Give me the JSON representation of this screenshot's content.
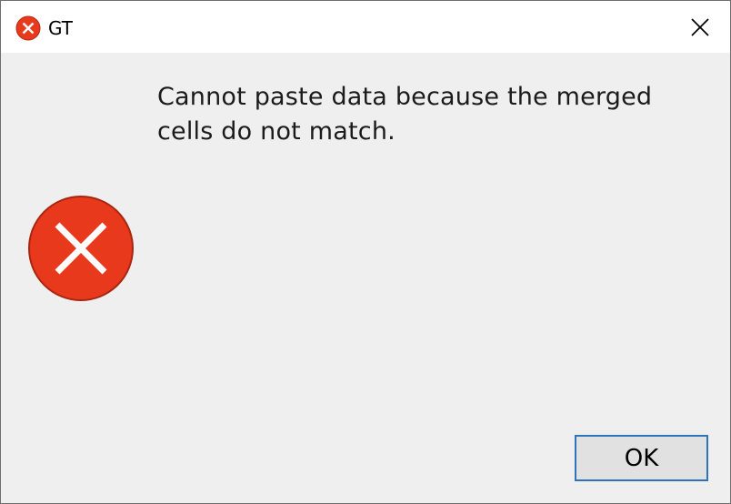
{
  "window": {
    "title": "GT",
    "title_icon": "error-circle-icon",
    "close_icon": "close-icon"
  },
  "dialog": {
    "message": "Cannot paste data because the merged cells do not match.",
    "icon": "error-icon",
    "ok_label": "OK"
  },
  "colors": {
    "error_red": "#e8391d",
    "button_border": "#2f73b9",
    "dialog_bg": "#efefef"
  }
}
